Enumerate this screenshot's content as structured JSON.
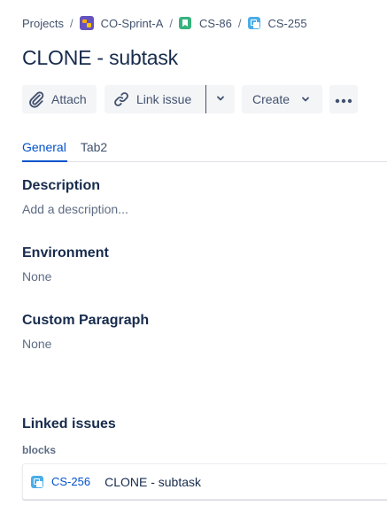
{
  "breadcrumb": {
    "items": [
      {
        "label": "Projects",
        "icon": ""
      },
      {
        "label": "CO-Sprint-A",
        "icon": "project-avatar-icon"
      },
      {
        "label": "CS-86",
        "icon": "story-icon"
      },
      {
        "label": "CS-255",
        "icon": "subtask-icon"
      }
    ],
    "separator": "/"
  },
  "issue": {
    "title": "CLONE - subtask"
  },
  "toolbar": {
    "attach_label": "Attach",
    "link_issue_label": "Link issue",
    "create_label": "Create"
  },
  "tabs": [
    {
      "label": "General",
      "active": true
    },
    {
      "label": "Tab2",
      "active": false
    }
  ],
  "fields": {
    "description": {
      "heading": "Description",
      "placeholder": "Add a description..."
    },
    "environment": {
      "heading": "Environment",
      "value": "None"
    },
    "custom_paragraph": {
      "heading": "Custom Paragraph",
      "value": "None"
    }
  },
  "linked_issues": {
    "heading": "Linked issues",
    "link_type": "blocks",
    "items": [
      {
        "key": "CS-256",
        "summary": "CLONE - subtask",
        "icon": "subtask-icon"
      }
    ]
  },
  "colors": {
    "link_blue": "#0052cc",
    "text_primary": "#172b4d",
    "text_secondary": "#5e6c84",
    "button_bg": "#f4f5f7",
    "story_green": "#36b37e",
    "subtask_blue": "#4bade8",
    "project_purple": "#6554c0"
  }
}
